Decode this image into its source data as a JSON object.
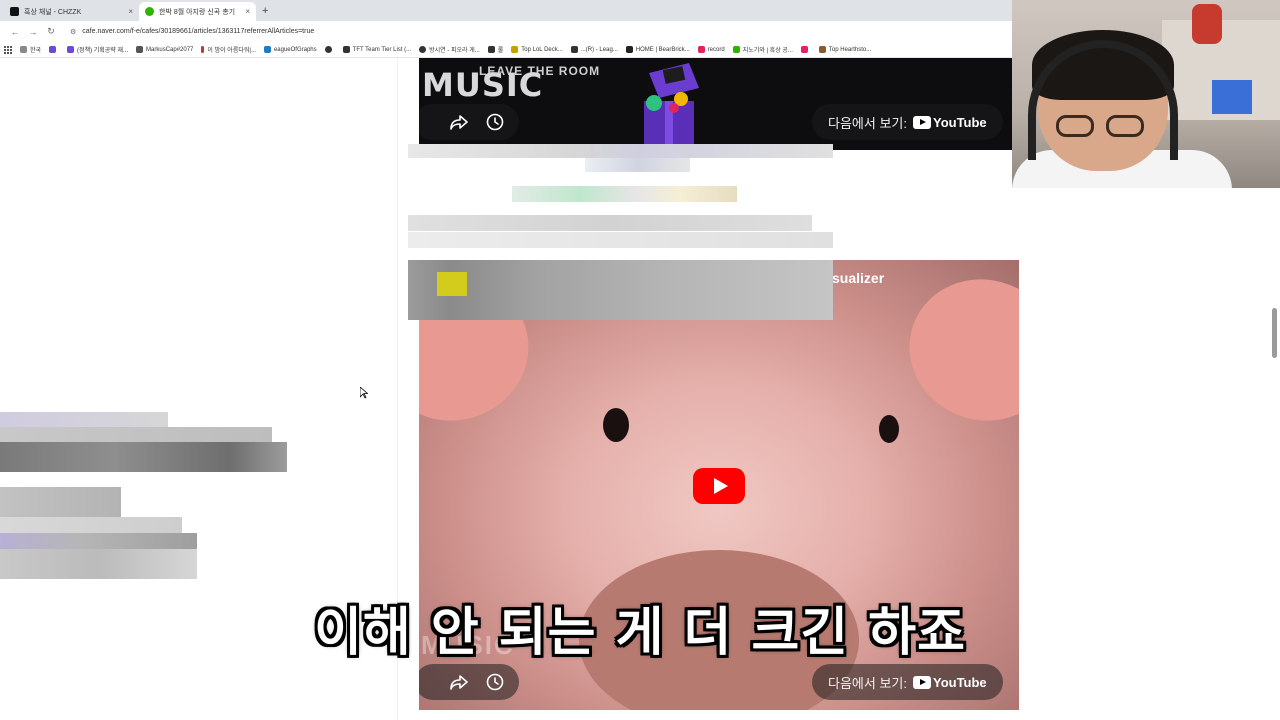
{
  "browser": {
    "tabs": [
      {
        "label": "흑상 채널 - CHZZK",
        "active": false,
        "favicon_color": "#111111"
      },
      {
        "label": "한박 8월 아지랑 신곡 총기",
        "active": true,
        "favicon_color": "#2db400"
      }
    ],
    "new_tab_symbol": "+",
    "close_symbol": "×",
    "url": "cafe.naver.com/f-e/cafes/30189661/articles/1363117referrerAllArticles=true",
    "bookmarks": [
      {
        "label": "한국",
        "color": "#888888"
      },
      {
        "label": "",
        "color": "#6b4bd1"
      },
      {
        "label": "(정책) 기획공략 재...",
        "color": "#6b4bd1"
      },
      {
        "label": "MarkusCap#2077",
        "color": "#555555"
      },
      {
        "label": "이 밤이 아름다워|...",
        "color": "#c0392b"
      },
      {
        "label": "eagueOfGraphs",
        "color": "#1e7bc6"
      },
      {
        "label": "",
        "color": "#333333"
      },
      {
        "label": "TFT Team Tier List (...",
        "color": "#333333"
      },
      {
        "label": "방시연 - 피오라 게...",
        "color": "#333333"
      },
      {
        "label": "롤",
        "color": "#333333"
      },
      {
        "label": "Top LoL Deck...",
        "color": "#c8a000"
      },
      {
        "label": "...(R) - Leag...",
        "color": "#333333"
      },
      {
        "label": "HOME | BearBrick...",
        "color": "#222222"
      },
      {
        "label": "record",
        "color": "#e0245e"
      },
      {
        "label": "지노기와 | 흑상 공...",
        "color": "#2db400"
      },
      {
        "label": "",
        "color": "#e0245e"
      },
      {
        "label": "Top Hearthsto...",
        "color": "#8b5a2b"
      }
    ]
  },
  "video_embed_top": {
    "title_art": "MUSIC",
    "subtitle_art": "LEAVE THE ROOM",
    "watch_on_label": "다음에서 보기:",
    "platform": "YouTube"
  },
  "video_embed_main": {
    "visible_title_fragment": "sualizer",
    "bottom_art": "MUSIC",
    "watch_on_label": "다음에서 보기:",
    "platform": "YouTube"
  },
  "subtitle": "이해 안 되는 게 더 크긴 하죠",
  "icons": {
    "share": "share-icon",
    "watch_later": "clock-icon",
    "play": "play-icon"
  }
}
